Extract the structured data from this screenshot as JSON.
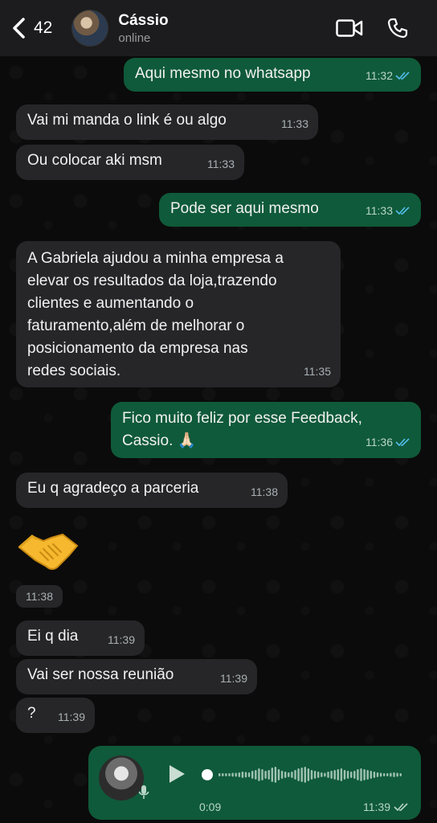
{
  "header": {
    "back_count": "42",
    "contact_name": "Cássio",
    "contact_status": "online",
    "icons": [
      "chevron-left-icon",
      "video-call-icon",
      "phone-icon"
    ]
  },
  "messages": [
    {
      "dir": "out",
      "text": "Aqui mesmo no whatsapp",
      "time": "11:32",
      "status": "read"
    },
    {
      "dir": "in",
      "text": "Vai mi manda o link é ou algo",
      "time": "11:33"
    },
    {
      "dir": "in",
      "text": "Ou colocar aki msm",
      "time": "11:33"
    },
    {
      "dir": "out",
      "text": "Pode ser aqui mesmo",
      "time": "11:33",
      "status": "read"
    },
    {
      "dir": "in",
      "lines": [
        "A Gabriela ajudou a minha empresa a",
        "elevar os resultados da loja,trazendo",
        "clientes e aumentando o",
        "faturamento,além de melhorar o",
        "posicionamento da empresa nas",
        "redes sociais."
      ],
      "time": "11:35"
    },
    {
      "dir": "out",
      "lines": [
        "Fico muito feliz por esse Feedback,",
        "Cassio. 🙏🏻"
      ],
      "time": "11:36",
      "status": "read"
    },
    {
      "dir": "in",
      "text": "Eu q agradeço a parceria",
      "time": "11:38"
    },
    {
      "dir": "in",
      "emoji": "handshake",
      "time": "11:38"
    },
    {
      "dir": "in",
      "text": "Ei q dia",
      "time": "11:39"
    },
    {
      "dir": "in",
      "text": "Vai ser nossa reunião",
      "time": "11:39"
    },
    {
      "dir": "in",
      "text": "?",
      "time": "11:39"
    }
  ],
  "voice_note": {
    "duration": "0:09",
    "time": "11:39",
    "status": "delivered",
    "progress": 0
  },
  "colors": {
    "incoming_bubble": "#262628",
    "outgoing_bubble": "#0f5a3a",
    "read_ticks": "#53bdeb",
    "background": "#0b0b0b"
  }
}
